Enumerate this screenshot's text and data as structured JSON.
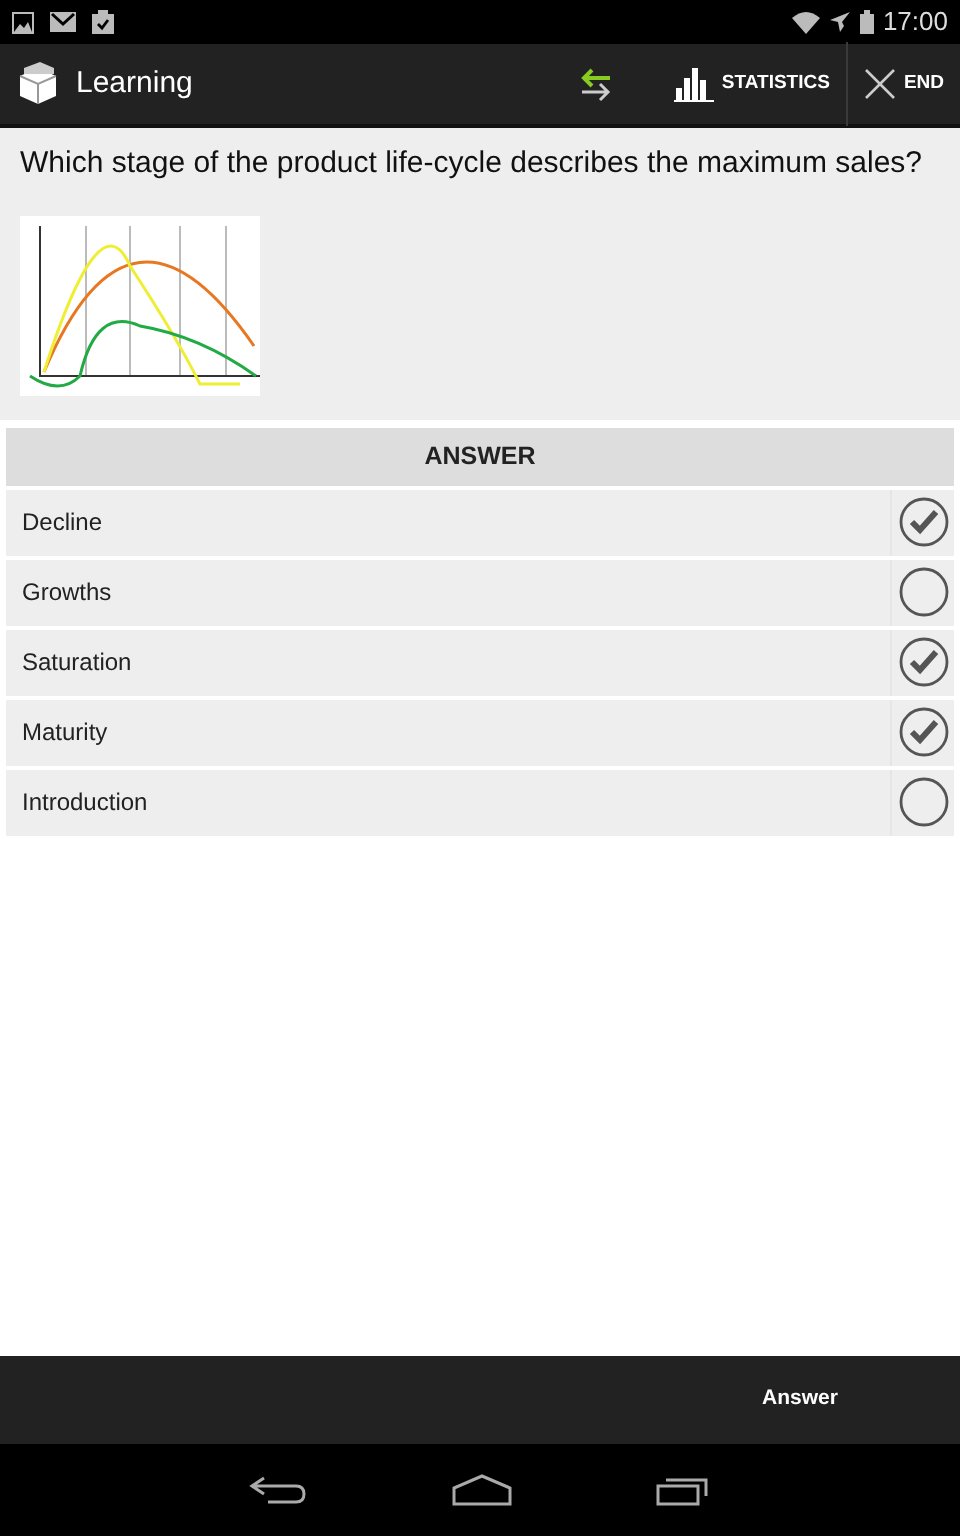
{
  "status_bar": {
    "time": "17:00"
  },
  "action_bar": {
    "title": "Learning",
    "actions": [
      {
        "kind": "swap"
      },
      {
        "kind": "statistics",
        "label": "STATISTICS"
      },
      {
        "kind": "end",
        "label": "END"
      }
    ]
  },
  "question": {
    "text": "Which stage of the product life-cycle describes the maximum sales?"
  },
  "answer_header": "ANSWER",
  "answers": [
    {
      "label": "Decline",
      "checked": true
    },
    {
      "label": "Growths",
      "checked": false
    },
    {
      "label": "Saturation",
      "checked": true
    },
    {
      "label": "Maturity",
      "checked": true
    },
    {
      "label": "Introduction",
      "checked": false
    }
  ],
  "bottom_bar": {
    "button": "Answer"
  }
}
